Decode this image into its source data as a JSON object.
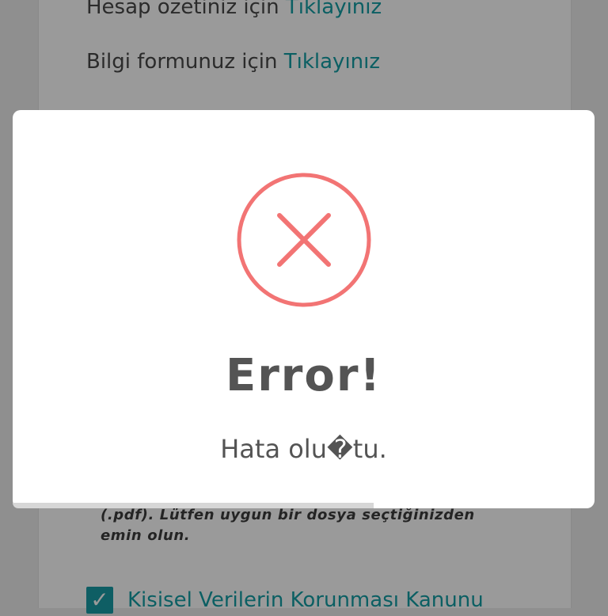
{
  "background": {
    "summary_line": {
      "text": "Hesap özetiniz için ",
      "link": "Tıklayınız"
    },
    "form_line": {
      "text": "Bilgi formunuz için ",
      "link": "Tıklayınız"
    },
    "note": "(.pdf). Lütfen uygun bir dosya seçtiğinizden emin olun.",
    "consent_label": "Kisisel Verilerin Korunması Kanunu"
  },
  "modal": {
    "icon": "error-x-circle-icon",
    "title": "Error!",
    "message": "Hata olu�tu.",
    "timer_progress": 0.62
  },
  "colors": {
    "link": "#0b5f63",
    "error_icon": "#f27474",
    "title_text": "#545454",
    "checkbox": "#0e5e64"
  }
}
